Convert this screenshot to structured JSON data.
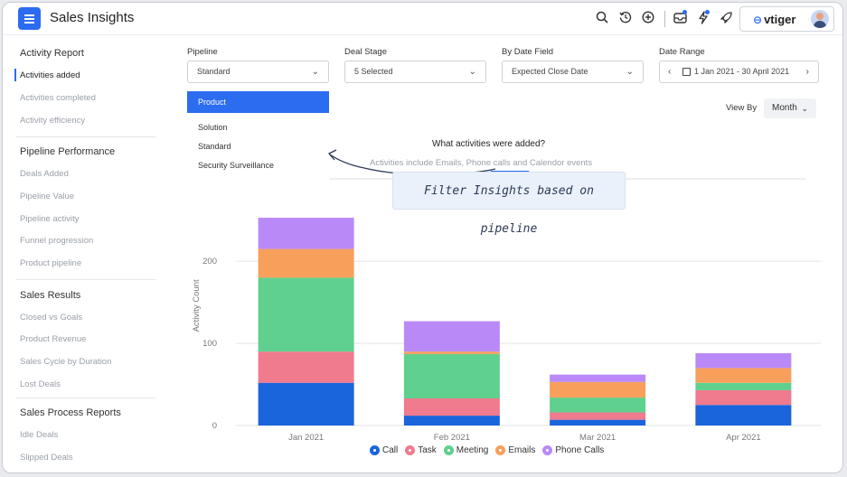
{
  "app": {
    "title": "Sales Insights",
    "brand": "vtiger"
  },
  "topbar": {
    "icons": [
      "search-icon",
      "history-icon",
      "add-circle-icon",
      "inbox-icon",
      "lightning-icon",
      "rocket-icon"
    ]
  },
  "sidebar": {
    "groups": [
      {
        "title": "Activity Report",
        "items": [
          "Activities added",
          "Activities completed",
          "Activity efficiency"
        ]
      },
      {
        "title": "Pipeline Performance",
        "items": [
          "Deals Added",
          "Pipeline Value",
          "Pipeline activity",
          "Funnel progression",
          "Product pipeline"
        ]
      },
      {
        "title": "Sales Results",
        "items": [
          "Closed vs Goals",
          "Product Revenue",
          "Sales Cycle by Duration",
          "Lost Deals"
        ]
      },
      {
        "title": "Sales Process Reports",
        "items": [
          "Idle Deals",
          "Slipped Deals"
        ]
      }
    ],
    "active_item": "Activities added"
  },
  "filters": {
    "pipeline": {
      "label": "Pipeline",
      "value": "Standard"
    },
    "deal_stage": {
      "label": "Deal Stage",
      "value": "5 Selected"
    },
    "date_field": {
      "label": "By Date Field",
      "value": "Expected Close Date"
    },
    "date_range": {
      "label": "Date Range",
      "value": "1 Jan 2021 - 30 April 2021"
    }
  },
  "pipeline_dropdown": {
    "options": [
      "Product",
      "Solution",
      "Standard",
      "Security Surveillance"
    ],
    "highlighted": "Product"
  },
  "view_by": {
    "label": "View By",
    "value": "Month"
  },
  "chart_header": {
    "title": "What activities were added?",
    "subtitle": "Activities include Emails, Phone calls and Calendor events"
  },
  "callout": {
    "text": "Filter Insights based on pipeline"
  },
  "chart_data": {
    "type": "bar",
    "stacked": true,
    "categories": [
      "Jan 2021",
      "Feb 2021",
      "Mar 2021",
      "Apr 2021"
    ],
    "series": [
      {
        "name": "Call",
        "color": "#1a64dc",
        "values": [
          52,
          12,
          7,
          25
        ]
      },
      {
        "name": "Task",
        "color": "#f07a8e",
        "values": [
          38,
          21,
          9,
          18
        ]
      },
      {
        "name": "Meeting",
        "color": "#5fd08e",
        "values": [
          90,
          54,
          18,
          9
        ]
      },
      {
        "name": "Emails",
        "color": "#f89f5b",
        "values": [
          35,
          3,
          19,
          18
        ]
      },
      {
        "name": "Phone Calls",
        "color": "#b98af7",
        "values": [
          38,
          37,
          9,
          18
        ]
      }
    ],
    "ylabel": "Activity Count",
    "ylim": [
      0,
      252
    ],
    "yticks": [
      0,
      100,
      200
    ],
    "grid": true,
    "legend": "bottom"
  }
}
